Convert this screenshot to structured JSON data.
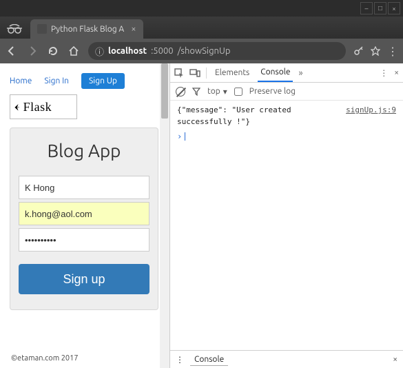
{
  "os": {
    "minimize": "–",
    "maximize": "□",
    "close": "×"
  },
  "browser": {
    "tab_title": "Python Flask Blog A",
    "url_host": "localhost",
    "url_port": ":5000",
    "url_path": "/showSignUp",
    "info_icon": "ⓘ"
  },
  "page": {
    "nav": {
      "home": "Home",
      "signin": "Sign In",
      "signup": "Sign Up"
    },
    "logo_text": "Flask",
    "card_title": "Blog App",
    "fields": {
      "name_value": "K Hong",
      "email_value": "k.hong@aol.com",
      "password_value": "••••••••••"
    },
    "submit_label": "Sign up",
    "footer": "©etaman.com 2017"
  },
  "devtools": {
    "tabs": {
      "elements": "Elements",
      "console": "Console"
    },
    "toolbar": {
      "context": "top",
      "preserve_label": "Preserve log"
    },
    "log": {
      "message": "{\"message\": \"User created successfully !\"}",
      "source": "signUp.js:9"
    },
    "prompt": "›",
    "drawer_tab": "Console"
  }
}
